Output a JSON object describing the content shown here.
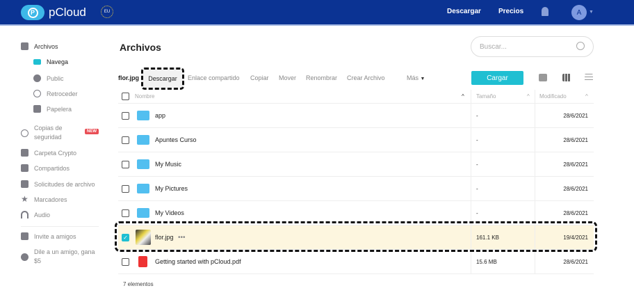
{
  "header": {
    "brand": "pCloud",
    "region": "EU",
    "nav": [
      "Descargar",
      "Precios"
    ],
    "avatar": "A"
  },
  "sidebar": {
    "items": [
      {
        "label": "Archivos",
        "icon": "file-icon"
      },
      {
        "label": "Navega",
        "icon": "list-icon"
      },
      {
        "label": "Public",
        "icon": "globe-icon"
      },
      {
        "label": "Retroceder",
        "icon": "history-icon"
      },
      {
        "label": "Papelera",
        "icon": "trash-icon"
      },
      {
        "label": "Copias de seguridad",
        "icon": "backup-icon",
        "badge": "NEW"
      },
      {
        "label": "Carpeta Crypto",
        "icon": "lock-icon"
      },
      {
        "label": "Compartidos",
        "icon": "shared-folder-icon"
      },
      {
        "label": "Solicitudes de archivo",
        "icon": "file-request-icon"
      },
      {
        "label": "Marcadores",
        "icon": "star-icon"
      },
      {
        "label": "Audio",
        "icon": "headphones-icon"
      },
      {
        "label": "Invite a amigos",
        "icon": "trophy-icon"
      },
      {
        "label": "Dile a un amigo, gana $5",
        "icon": "dollar-icon"
      }
    ]
  },
  "main": {
    "title": "Archivos",
    "search_placeholder": "Buscar...",
    "toolbar": {
      "selected": "flor.jpg",
      "actions": [
        "Descargar",
        "Enlace compartido",
        "Copiar",
        "Mover",
        "Renombrar",
        "Crear Archivo",
        "Más"
      ],
      "upload": "Cargar"
    },
    "columns": [
      "Nombre",
      "Tamaño",
      "Modificado"
    ],
    "rows": [
      {
        "name": "app",
        "size": "-",
        "modified": "28/6/2021",
        "type": "folder"
      },
      {
        "name": "Apuntes Curso",
        "size": "-",
        "modified": "28/6/2021",
        "type": "folder"
      },
      {
        "name": "My Music",
        "size": "-",
        "modified": "28/6/2021",
        "type": "folder"
      },
      {
        "name": "My Pictures",
        "size": "-",
        "modified": "28/6/2021",
        "type": "folder"
      },
      {
        "name": "My Videos",
        "size": "-",
        "modified": "28/6/2021",
        "type": "folder"
      },
      {
        "name": "flor.jpg",
        "size": "161.1 KB",
        "modified": "19/4/2021",
        "type": "image",
        "selected": true
      },
      {
        "name": "Getting started with pCloud.pdf",
        "size": "15.6 MB",
        "modified": "28/6/2021",
        "type": "pdf"
      }
    ],
    "footer": "7 elementos"
  },
  "colors": {
    "header": "#0b3393",
    "accent": "#1fbfd2",
    "selected_row": "#fdf6df"
  }
}
